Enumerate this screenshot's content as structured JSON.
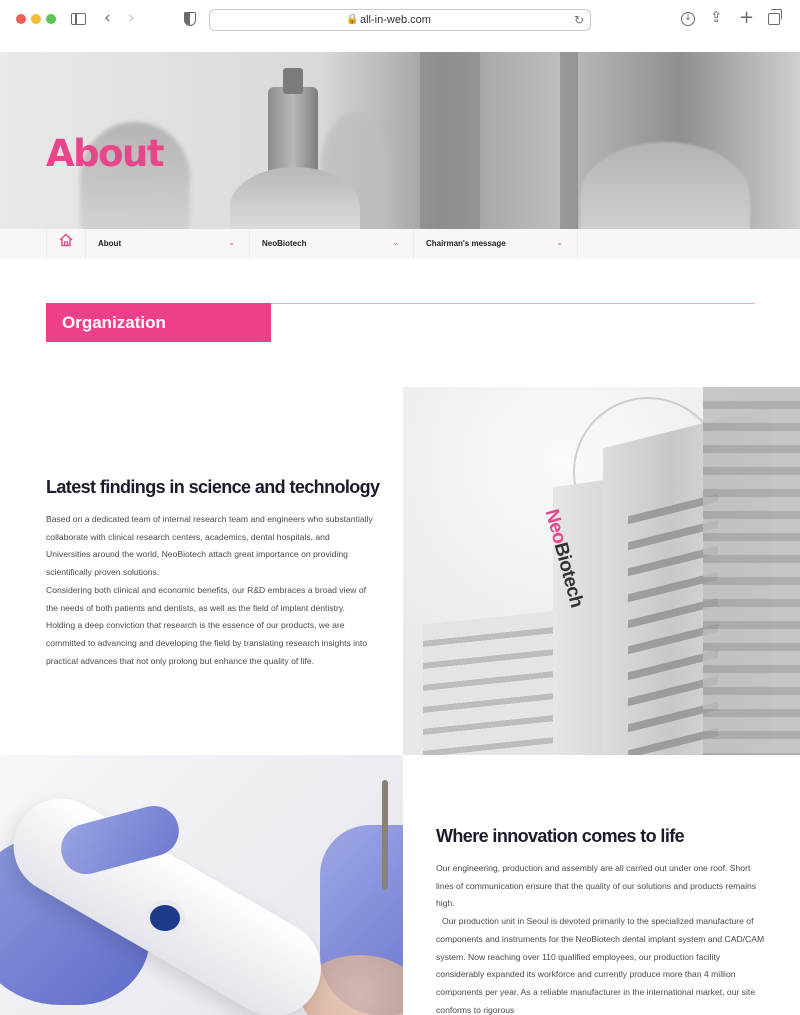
{
  "browser": {
    "url": "all-in-web.com"
  },
  "hero": {
    "title": "About"
  },
  "subnav": {
    "items": [
      {
        "label": "About"
      },
      {
        "label": "NeoBiotech"
      },
      {
        "label": "Chairman's message"
      }
    ]
  },
  "section": {
    "heading": "Organization"
  },
  "science": {
    "title": "Latest findings in science and technology",
    "paragraphs": [
      "Based on a dedicated team of internal research team and engineers who substantially collaborate with clinical research centers, academics, dental hospitals, and Universities around the world, NeoBiotech attach great importance on providing scientifically proven solutions.",
      "Considering both clinical and economic benefits, our R&D embraces a broad view of the needs of both patients and dentists, as well as the field of implant dentistry. Holding a deep conviction that research is the essence of our products, we are committed to advancing and developing the field by translating research insights into practical advances that not only prolong but enhance the quality of life."
    ],
    "building_logo": {
      "neo": "Neo",
      "biotech": "Biotech"
    }
  },
  "innovation": {
    "title": "Where innovation comes to life",
    "paragraphs": [
      "Our engineering, production and assembly are all carried out under one roof. Short lines of communication ensure that the quality of our solutions and products remains high.",
      "Our production unit in Seoul is devoted primarily to the specialized manufacture of components and instruments for the NeoBiotech dental implant system and CAD/CAM system. Now reaching over 110 qualified employees, our production facility considerably expanded its workforce and currently produce more than 4 million components per year. As a reliable manufacturer in the international market, our site conforms to rigorous"
    ]
  },
  "colors": {
    "accent": "#ee4089",
    "title_dark": "#1b1b2c"
  },
  "icons": [
    "sidebar-icon",
    "back-icon",
    "forward-icon",
    "shield-icon",
    "lock-icon",
    "reload-icon",
    "download-icon",
    "share-icon",
    "new-tab-icon",
    "tabs-icon",
    "home-icon",
    "chevron-down-icon"
  ]
}
